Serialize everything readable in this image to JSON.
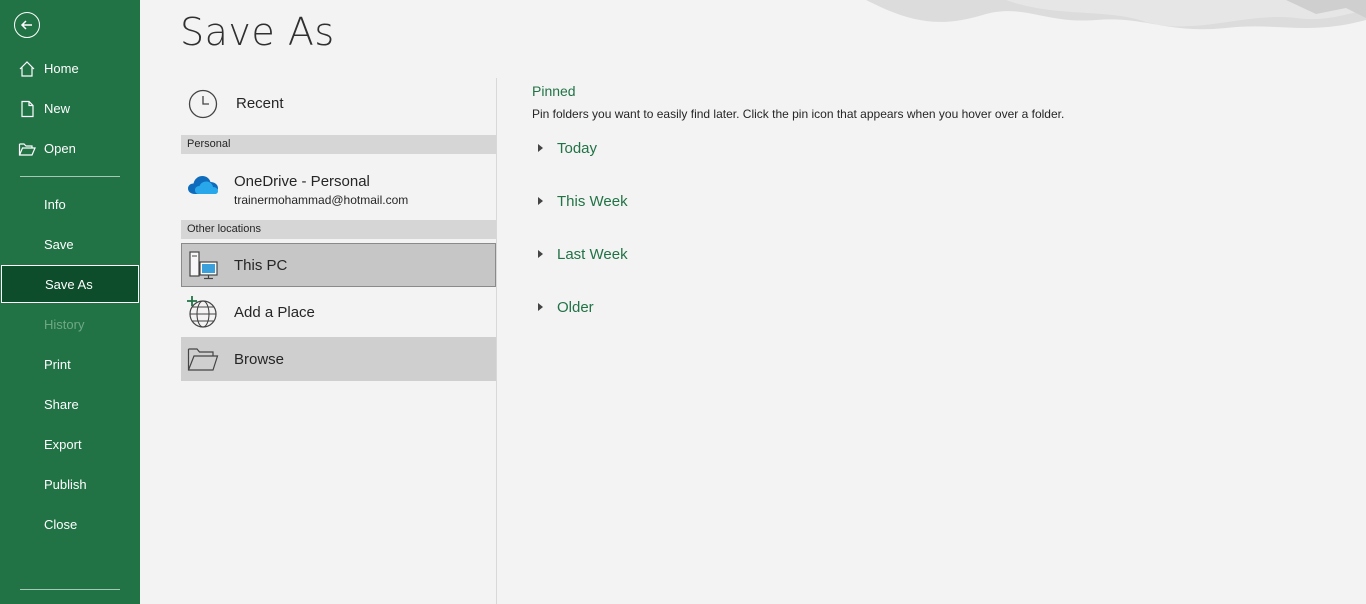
{
  "sidebar": {
    "back_icon": "back-arrow-icon",
    "items": [
      {
        "label": "Home",
        "icon": "home-icon"
      },
      {
        "label": "New",
        "icon": "new-document-icon"
      },
      {
        "label": "Open",
        "icon": "open-folder-icon"
      },
      {
        "label": "Info"
      },
      {
        "label": "Save"
      },
      {
        "label": "Save As",
        "selected": true
      },
      {
        "label": "History",
        "disabled": true
      },
      {
        "label": "Print"
      },
      {
        "label": "Share"
      },
      {
        "label": "Export"
      },
      {
        "label": "Publish"
      },
      {
        "label": "Close"
      }
    ]
  },
  "page": {
    "title": "Save As"
  },
  "locations": {
    "recent": {
      "label": "Recent",
      "icon": "clock-icon"
    },
    "personal_header": "Personal",
    "onedrive": {
      "label": "OneDrive - Personal",
      "email": "trainermohammad@hotmail.com",
      "icon": "onedrive-cloud-icon"
    },
    "other_header": "Other locations",
    "this_pc": {
      "label": "This PC",
      "icon": "computer-icon"
    },
    "add_place": {
      "label": "Add a Place",
      "icon": "globe-add-icon"
    },
    "browse": {
      "label": "Browse",
      "icon": "folder-icon"
    }
  },
  "pinned": {
    "title": "Pinned",
    "description": "Pin folders you want to easily find later. Click the pin icon that appears when you hover over a folder.",
    "groups": [
      "Today",
      "This Week",
      "Last Week",
      "Older"
    ]
  },
  "colors": {
    "brand": "#217346",
    "selected_nav": "#0e4d2b",
    "background": "#f3f3f3"
  }
}
